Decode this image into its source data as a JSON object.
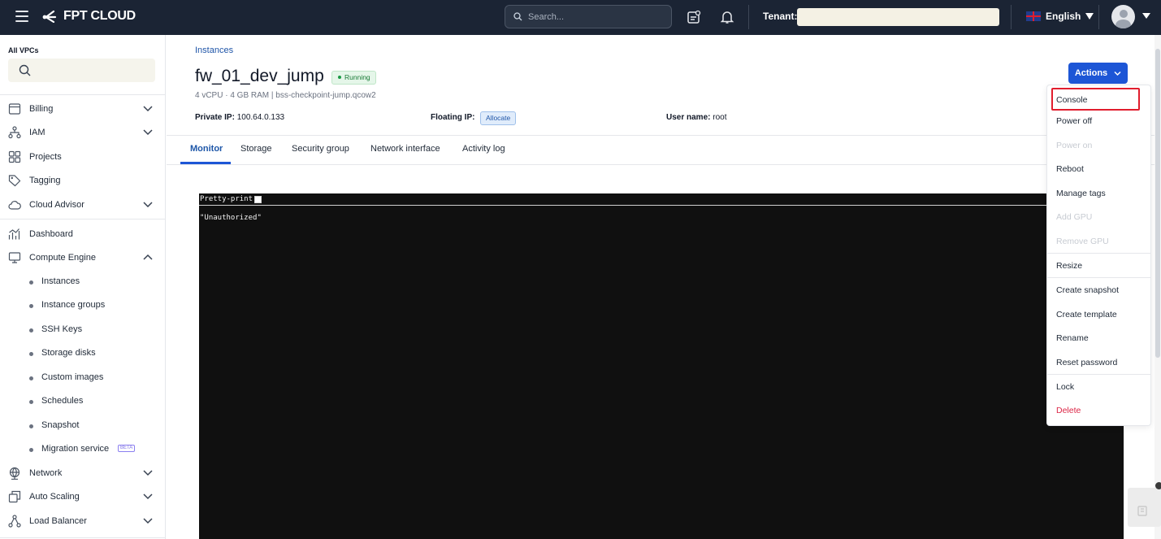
{
  "topbar": {
    "brand": "FPT CLOUD",
    "search_placeholder": "Search...",
    "tenant_label": "Tenant:",
    "language": "English"
  },
  "sidebar": {
    "title": "All VPCs",
    "items": [
      {
        "label": "Billing",
        "icon": "billing-icon",
        "expandable": true
      },
      {
        "label": "IAM",
        "icon": "iam-icon",
        "expandable": true
      },
      {
        "label": "Projects",
        "icon": "projects-icon",
        "expandable": false
      },
      {
        "label": "Tagging",
        "icon": "tag-icon",
        "expandable": false
      },
      {
        "label": "Cloud Advisor",
        "icon": "cloud-advisor-icon",
        "expandable": true
      },
      {
        "label": "Dashboard",
        "icon": "dashboard-icon",
        "expandable": false
      },
      {
        "label": "Compute Engine",
        "icon": "compute-icon",
        "expandable": true,
        "expanded": true
      },
      {
        "label": "Network",
        "icon": "network-icon",
        "expandable": true
      },
      {
        "label": "Auto Scaling",
        "icon": "auto-scaling-icon",
        "expandable": true
      },
      {
        "label": "Load Balancer",
        "icon": "load-balancer-icon",
        "expandable": true
      }
    ],
    "compute_subitems": [
      {
        "label": "Instances"
      },
      {
        "label": "Instance groups"
      },
      {
        "label": "SSH Keys"
      },
      {
        "label": "Storage disks"
      },
      {
        "label": "Custom images"
      },
      {
        "label": "Schedules"
      },
      {
        "label": "Snapshot"
      },
      {
        "label": "Migration service",
        "badge": "BETA"
      }
    ]
  },
  "header": {
    "breadcrumb": "Instances",
    "instance_name": "fw_01_dev_jump",
    "status": "Running",
    "spec": "4 vCPU · 4 GB RAM | bss-checkpoint-jump.qcow2",
    "private_ip_label": "Private IP:",
    "private_ip": "100.64.0.133",
    "floating_ip_label": "Floating IP:",
    "floating_ip_action": "Allocate",
    "username_label": "User name:",
    "username": "root",
    "actions_label": "Actions"
  },
  "tabs": [
    {
      "label": "Monitor",
      "active": true
    },
    {
      "label": "Storage"
    },
    {
      "label": "Security group"
    },
    {
      "label": "Network interface"
    },
    {
      "label": "Activity log"
    }
  ],
  "console": {
    "pretty_print_label": "Pretty-print",
    "content": "\"Unauthorized\""
  },
  "actions_menu": {
    "items": [
      {
        "label": "Console",
        "highlighted": true
      },
      {
        "label": "Power off"
      },
      {
        "label": "Power on",
        "disabled": true
      },
      {
        "label": "Reboot"
      },
      {
        "label": "Manage tags"
      },
      {
        "label": "Add GPU",
        "disabled": true
      },
      {
        "label": "Remove GPU",
        "disabled": true
      },
      {
        "label": "Resize"
      },
      {
        "label": "Create snapshot"
      },
      {
        "label": "Create template"
      },
      {
        "label": "Rename"
      },
      {
        "label": "Reset password"
      },
      {
        "label": "Lock"
      },
      {
        "label": "Delete",
        "danger": true
      }
    ]
  },
  "colors": {
    "topbar": "#1b2434",
    "primary": "#1d56d6",
    "danger": "#dc2646",
    "running": "#187a36"
  }
}
